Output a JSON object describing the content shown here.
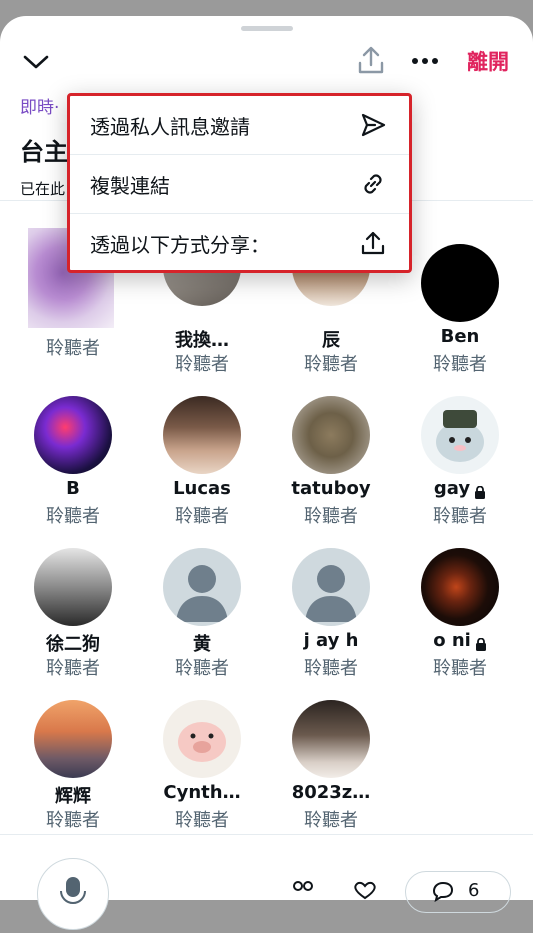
{
  "header": {
    "leave_label": "離開",
    "live_label": "即時·",
    "title": "台主",
    "subtitle": "已在此"
  },
  "share_menu": {
    "items": [
      {
        "label": "透過私人訊息邀請",
        "icon": "send-icon"
      },
      {
        "label": "複製連結",
        "icon": "link-icon"
      },
      {
        "label": "透過以下方式分享：",
        "icon": "share-icon"
      }
    ]
  },
  "participants": [
    {
      "name": "",
      "role": "聆聽者"
    },
    {
      "name": "我換…",
      "role": "聆聽者"
    },
    {
      "name": "辰",
      "role": "聆聽者"
    },
    {
      "name": "Ben",
      "role": "聆聽者"
    },
    {
      "name": "B",
      "role": "聆聽者"
    },
    {
      "name": "Lucas",
      "role": "聆聽者"
    },
    {
      "name": "tatuboy",
      "role": "聆聽者"
    },
    {
      "name": "gay",
      "role": "聆聽者",
      "locked": true
    },
    {
      "name": "徐二狗",
      "role": "聆聽者"
    },
    {
      "name": "黄",
      "role": "聆聽者"
    },
    {
      "name": "j ay h",
      "role": "聆聽者"
    },
    {
      "name": "o ni",
      "role": "聆聽者",
      "locked": true
    },
    {
      "name": "辉辉",
      "role": "聆聽者"
    },
    {
      "name": "Cynth…",
      "role": "聆聽者"
    },
    {
      "name": "8023z…",
      "role": "聆聽者"
    }
  ],
  "bottom_bar": {
    "reaction_count": "6"
  },
  "colors": {
    "accent_purple": "#794bc4",
    "leave_red": "#e0245e",
    "highlight_border": "#d6232a",
    "muted_text": "#536471"
  }
}
